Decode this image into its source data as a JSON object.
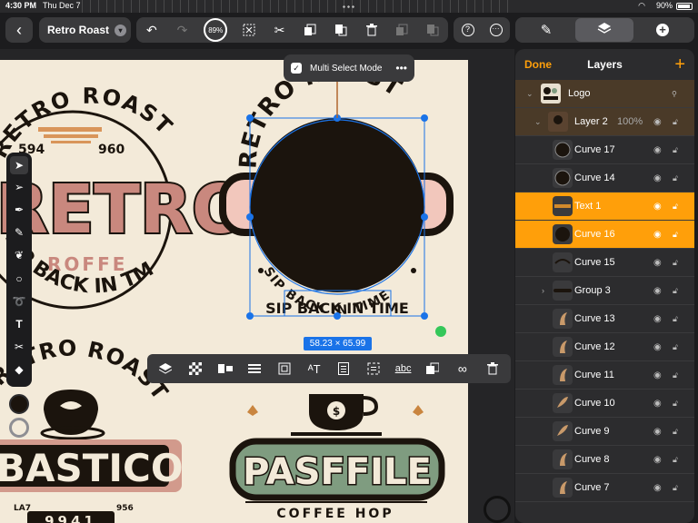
{
  "status_bar": {
    "time": "4:30 PM",
    "date": "Thu Dec 7",
    "battery": "90%"
  },
  "document": {
    "title": "Retro Roast"
  },
  "toolbar": {
    "zoom": "89%"
  },
  "multi_select": {
    "label": "Multi Select Mode"
  },
  "selection": {
    "dimensions": "58.23 × 65.99"
  },
  "layers_panel": {
    "done_label": "Done",
    "title": "Layers",
    "add_label": "+",
    "rows": [
      {
        "name": "Logo",
        "opacity": "",
        "style": "group",
        "level": 0,
        "expander": "⌄"
      },
      {
        "name": "Layer 2",
        "opacity": "100%",
        "style": "group",
        "level": 1,
        "expander": "⌄"
      },
      {
        "name": "Curve 17",
        "opacity": "",
        "style": "normal",
        "level": 2,
        "expander": ""
      },
      {
        "name": "Curve 14",
        "opacity": "",
        "style": "normal",
        "level": 2,
        "expander": ""
      },
      {
        "name": "Text 1",
        "opacity": "",
        "style": "selected",
        "level": 2,
        "expander": ""
      },
      {
        "name": "Curve 16",
        "opacity": "",
        "style": "selected",
        "level": 2,
        "expander": ""
      },
      {
        "name": "Curve 15",
        "opacity": "",
        "style": "normal",
        "level": 2,
        "expander": ""
      },
      {
        "name": "Group 3",
        "opacity": "",
        "style": "normal",
        "level": 2,
        "expander": "›"
      },
      {
        "name": "Curve 13",
        "opacity": "",
        "style": "normal",
        "level": 2,
        "expander": ""
      },
      {
        "name": "Curve 12",
        "opacity": "",
        "style": "normal",
        "level": 2,
        "expander": ""
      },
      {
        "name": "Curve 11",
        "opacity": "",
        "style": "normal",
        "level": 2,
        "expander": ""
      },
      {
        "name": "Curve 10",
        "opacity": "",
        "style": "normal",
        "level": 2,
        "expander": ""
      },
      {
        "name": "Curve 9",
        "opacity": "",
        "style": "normal",
        "level": 2,
        "expander": ""
      },
      {
        "name": "Curve 8",
        "opacity": "",
        "style": "normal",
        "level": 2,
        "expander": ""
      },
      {
        "name": "Curve 7",
        "opacity": "",
        "style": "normal",
        "level": 2,
        "expander": ""
      }
    ]
  },
  "artwork": {
    "logo1_arc": "RETRO ROAST",
    "logo1_num_left": "594",
    "logo1_num_right": "960",
    "logo1_main": "RETRO",
    "logo1_sub": "ROFFE",
    "logo1_bottom": "SIP BACK IN TME",
    "center_arc_top": "RETRO ROAST",
    "center_arc_bottom": "SIP BACK IN TIME",
    "center_box_text": "SIP BACK IN TIME",
    "logo3_arc": "RETRO ROAST",
    "logo3_main": "BASTICO",
    "logo3_num_left": "LA7",
    "logo3_num_right": "956",
    "logo3_code": "9941",
    "logo4_main": "PASFFILE",
    "logo4_sub": "COFFEE HOP",
    "coin_symbol": "$"
  },
  "colors": {
    "accent": "#ff9f0a",
    "selection": "#1a73e8",
    "artboard": "#f3ead9",
    "ink": "#1b140d"
  }
}
